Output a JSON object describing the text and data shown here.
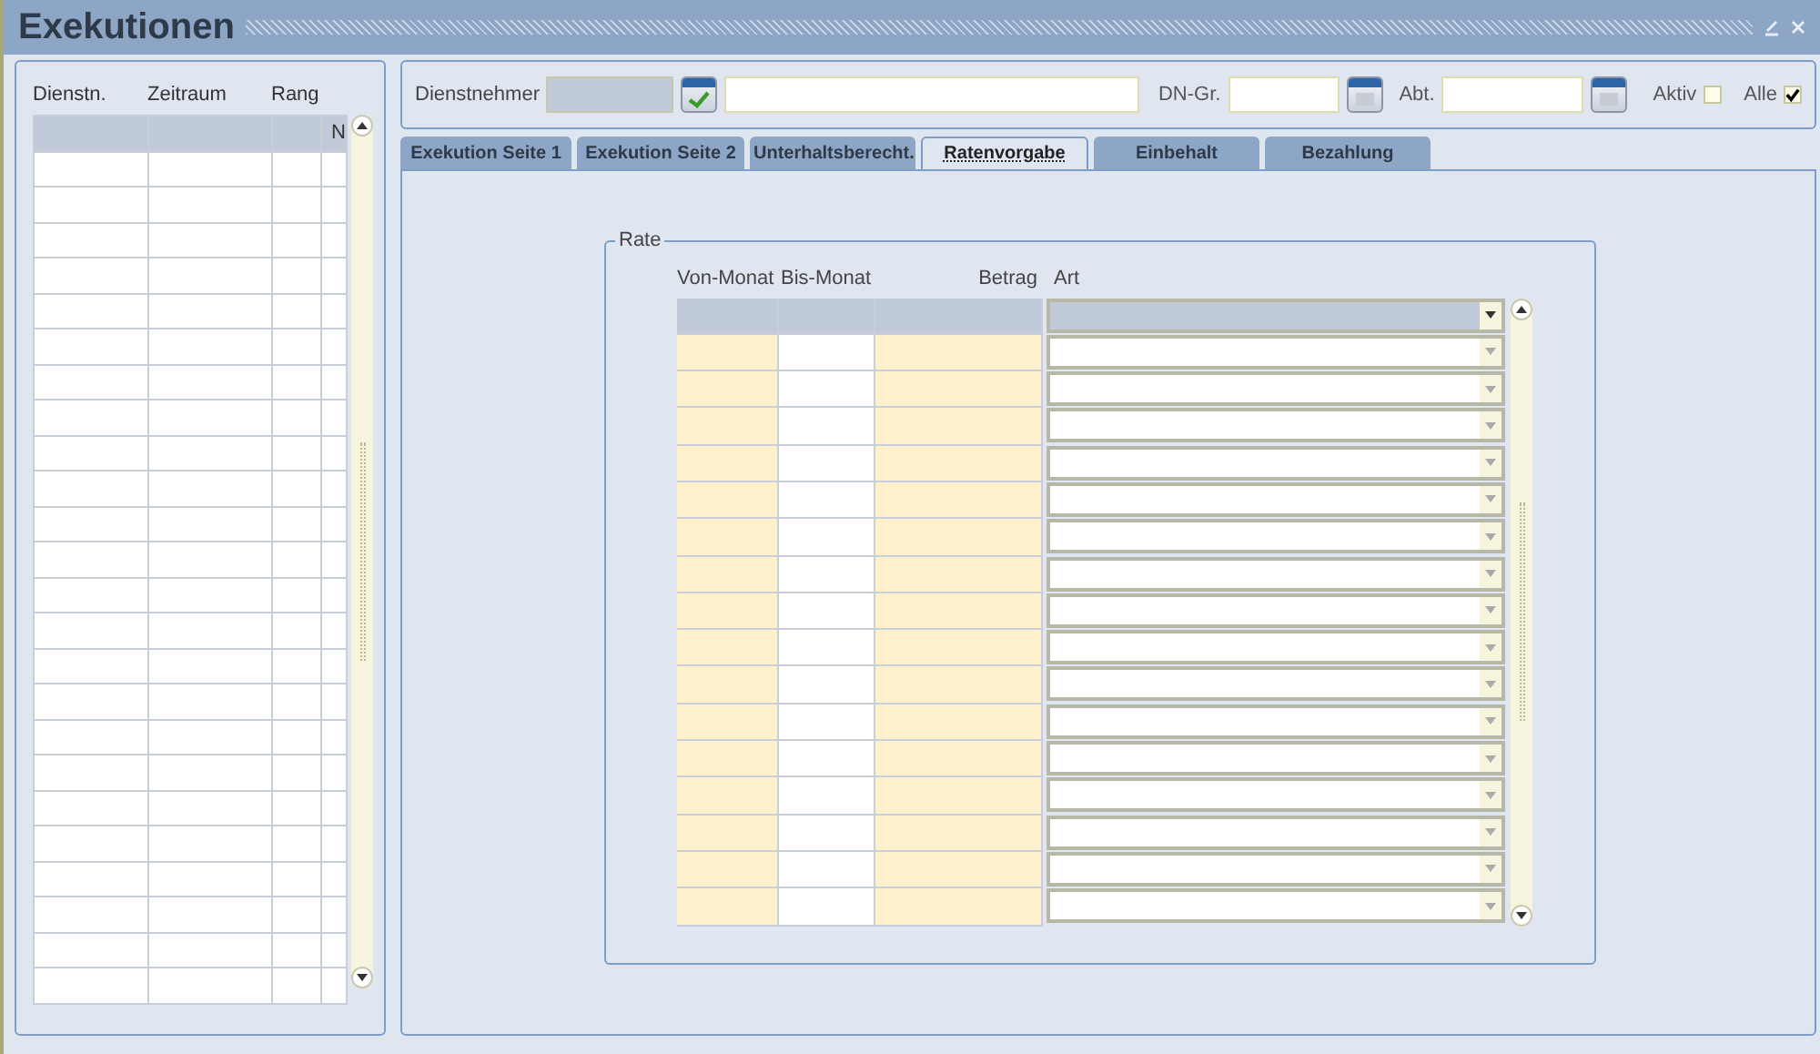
{
  "window": {
    "title": "Exekutionen"
  },
  "left_table": {
    "columns": [
      "Dienstn.",
      "Zeitraum",
      "Rang"
    ],
    "column_4": "N",
    "rows": [
      {
        "selected": true
      },
      {
        "selected": false
      },
      {
        "selected": false
      },
      {
        "selected": false
      },
      {
        "selected": false
      },
      {
        "selected": false
      },
      {
        "selected": false
      },
      {
        "selected": false
      },
      {
        "selected": false
      },
      {
        "selected": false
      },
      {
        "selected": false
      },
      {
        "selected": false
      },
      {
        "selected": false
      },
      {
        "selected": false
      },
      {
        "selected": false
      },
      {
        "selected": false
      },
      {
        "selected": false
      },
      {
        "selected": false
      },
      {
        "selected": false
      },
      {
        "selected": false
      },
      {
        "selected": false
      },
      {
        "selected": false
      },
      {
        "selected": false
      },
      {
        "selected": false
      },
      {
        "selected": false
      }
    ]
  },
  "filter": {
    "employee_label": "Dienstnehmer",
    "group_label": "DN-Gr.",
    "dept_label": "Abt.",
    "active": {
      "label": "Aktiv",
      "checked": false
    },
    "all": {
      "label": "Alle",
      "checked": true
    }
  },
  "tabs": [
    {
      "label": "Exekution Seite 1",
      "selected": false
    },
    {
      "label": "Exekution Seite 2",
      "selected": false
    },
    {
      "label": "Unterhaltsberecht.",
      "selected": false
    },
    {
      "label": "Ratenvorgabe",
      "selected": true
    },
    {
      "label": "Einbehalt",
      "selected": false
    },
    {
      "label": "Bezahlung",
      "selected": false
    }
  ],
  "rate": {
    "title": "Rate",
    "columns": [
      "Von-Monat",
      "Bis-Monat",
      "Betrag",
      "Art"
    ],
    "rows": [
      {
        "selected": true
      },
      {
        "selected": false
      },
      {
        "selected": false
      },
      {
        "selected": false
      },
      {
        "selected": false
      },
      {
        "selected": false
      },
      {
        "selected": false
      },
      {
        "selected": false
      },
      {
        "selected": false
      },
      {
        "selected": false
      },
      {
        "selected": false
      },
      {
        "selected": false
      },
      {
        "selected": false
      },
      {
        "selected": false
      },
      {
        "selected": false
      },
      {
        "selected": false
      },
      {
        "selected": false
      }
    ]
  }
}
